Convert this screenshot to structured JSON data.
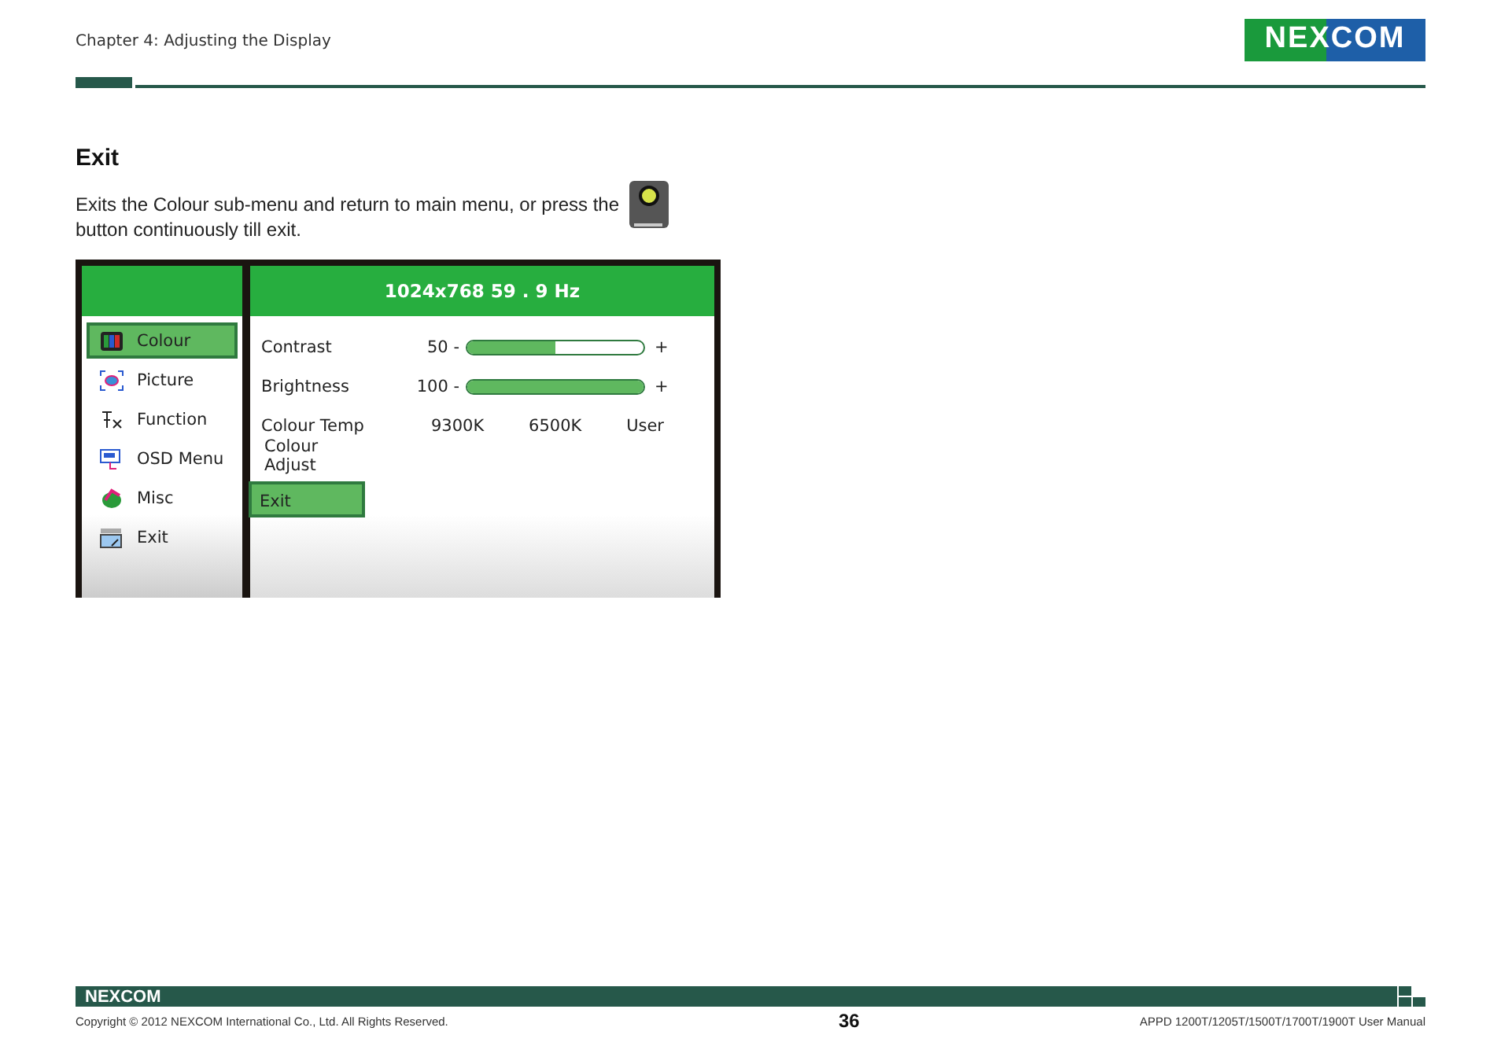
{
  "header": {
    "chapter": "Chapter 4: Adjusting the Display",
    "logo": "NEXCOM"
  },
  "section": {
    "title": "Exit",
    "text_before": "Exits the Colour sub-menu and return to main menu, or press the",
    "text_after": "button continuously till exit."
  },
  "osd": {
    "resolution": "1024x768  59  . 9 Hz",
    "menu": [
      {
        "label": "Colour",
        "selected": true
      },
      {
        "label": "Picture",
        "selected": false
      },
      {
        "label": "Function",
        "selected": false
      },
      {
        "label": "OSD Menu",
        "selected": false
      },
      {
        "label": "Misc",
        "selected": false
      },
      {
        "label": "Exit",
        "selected": false
      }
    ],
    "settings": [
      {
        "kind": "slider",
        "label": "Contrast",
        "reading": "50 -",
        "level": 0.5,
        "plus": "+"
      },
      {
        "kind": "slider",
        "label": "Brightness",
        "reading": "100 -",
        "level": 1,
        "plus": "+"
      },
      {
        "kind": "options",
        "label": "Colour Temp",
        "options": [
          "9300K",
          "6500K",
          "User"
        ]
      },
      {
        "kind": "item",
        "label": "Colour Adjust",
        "selected": false
      },
      {
        "kind": "item",
        "label": "Exit",
        "selected": true
      }
    ]
  },
  "footer": {
    "logo": "NEXCOM",
    "copyright": "Copyright © 2012 NEXCOM International Co., Ltd. All Rights Reserved.",
    "page": "36",
    "manual": "APPD 1200T/1205T/1500T/1700T/1900T User Manual"
  }
}
